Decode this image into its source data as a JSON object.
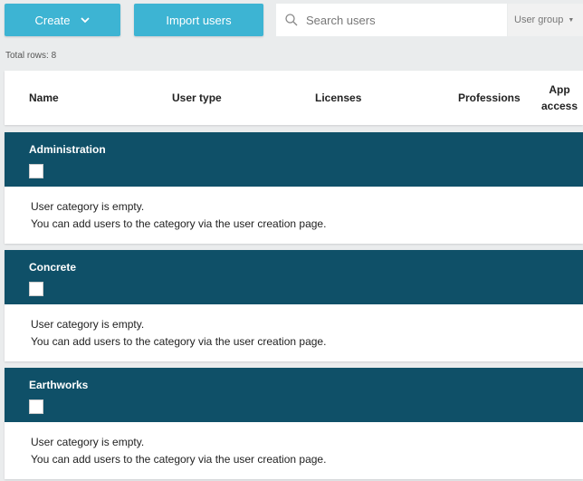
{
  "toolbar": {
    "create_label": "Create",
    "import_label": "Import users",
    "search_placeholder": "Search users",
    "user_group_label": "User group"
  },
  "total_rows": "Total rows: 8",
  "table": {
    "columns": [
      "Name",
      "User type",
      "Licenses",
      "Professions",
      "App access"
    ]
  },
  "groups": [
    {
      "name": "Administration",
      "empty_line1": "User category is empty.",
      "empty_line2": "You can add users to the category via the user creation page."
    },
    {
      "name": "Concrete",
      "empty_line1": "User category is empty.",
      "empty_line2": "You can add users to the category via the user creation page."
    },
    {
      "name": "Earthworks",
      "empty_line1": "User category is empty.",
      "empty_line2": "You can add users to the category via the user creation page."
    }
  ],
  "colors": {
    "accent_button": "#3db4d3",
    "group_header": "#0f5068",
    "background": "#eaeced"
  }
}
